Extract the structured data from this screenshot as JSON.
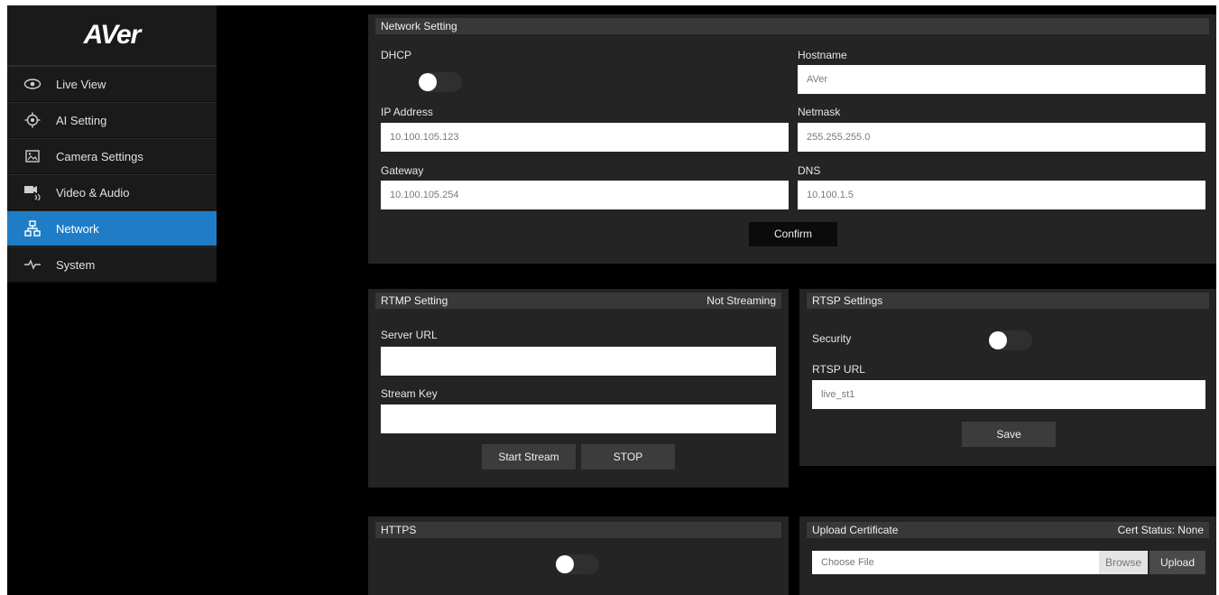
{
  "brand": {
    "logo_text": "AVer"
  },
  "sidebar": {
    "items": [
      {
        "label": "Live View",
        "icon": "eye-icon"
      },
      {
        "label": "AI Setting",
        "icon": "target-icon"
      },
      {
        "label": "Camera Settings",
        "icon": "image-icon"
      },
      {
        "label": "Video & Audio",
        "icon": "video-audio-icon"
      },
      {
        "label": "Network",
        "icon": "network-icon",
        "active": true
      },
      {
        "label": "System",
        "icon": "pulse-icon"
      }
    ]
  },
  "network": {
    "title": "Network Setting",
    "dhcp_label": "DHCP",
    "dhcp_enabled": false,
    "hostname_label": "Hostname",
    "hostname_value": "AVer",
    "ip_label": "IP Address",
    "ip_value": "10.100.105.123",
    "netmask_label": "Netmask",
    "netmask_value": "255.255.255.0",
    "gateway_label": "Gateway",
    "gateway_value": "10.100.105.254",
    "dns_label": "DNS",
    "dns_value": "10.100.1.5",
    "confirm_label": "Confirm"
  },
  "rtmp": {
    "title": "RTMP Setting",
    "status": "Not Streaming",
    "server_url_label": "Server URL",
    "server_url_value": "",
    "stream_key_label": "Stream Key",
    "stream_key_value": "",
    "start_label": "Start Stream",
    "stop_label": "STOP"
  },
  "rtsp": {
    "title": "RTSP Settings",
    "security_label": "Security",
    "security_enabled": false,
    "url_label": "RTSP URL",
    "url_value": "live_st1",
    "save_label": "Save"
  },
  "https": {
    "title": "HTTPS",
    "enabled": false
  },
  "certificate": {
    "title": "Upload Certificate",
    "status": "Cert Status: None",
    "file_placeholder": "Choose File",
    "browse_label": "Browse",
    "upload_label": "Upload"
  }
}
